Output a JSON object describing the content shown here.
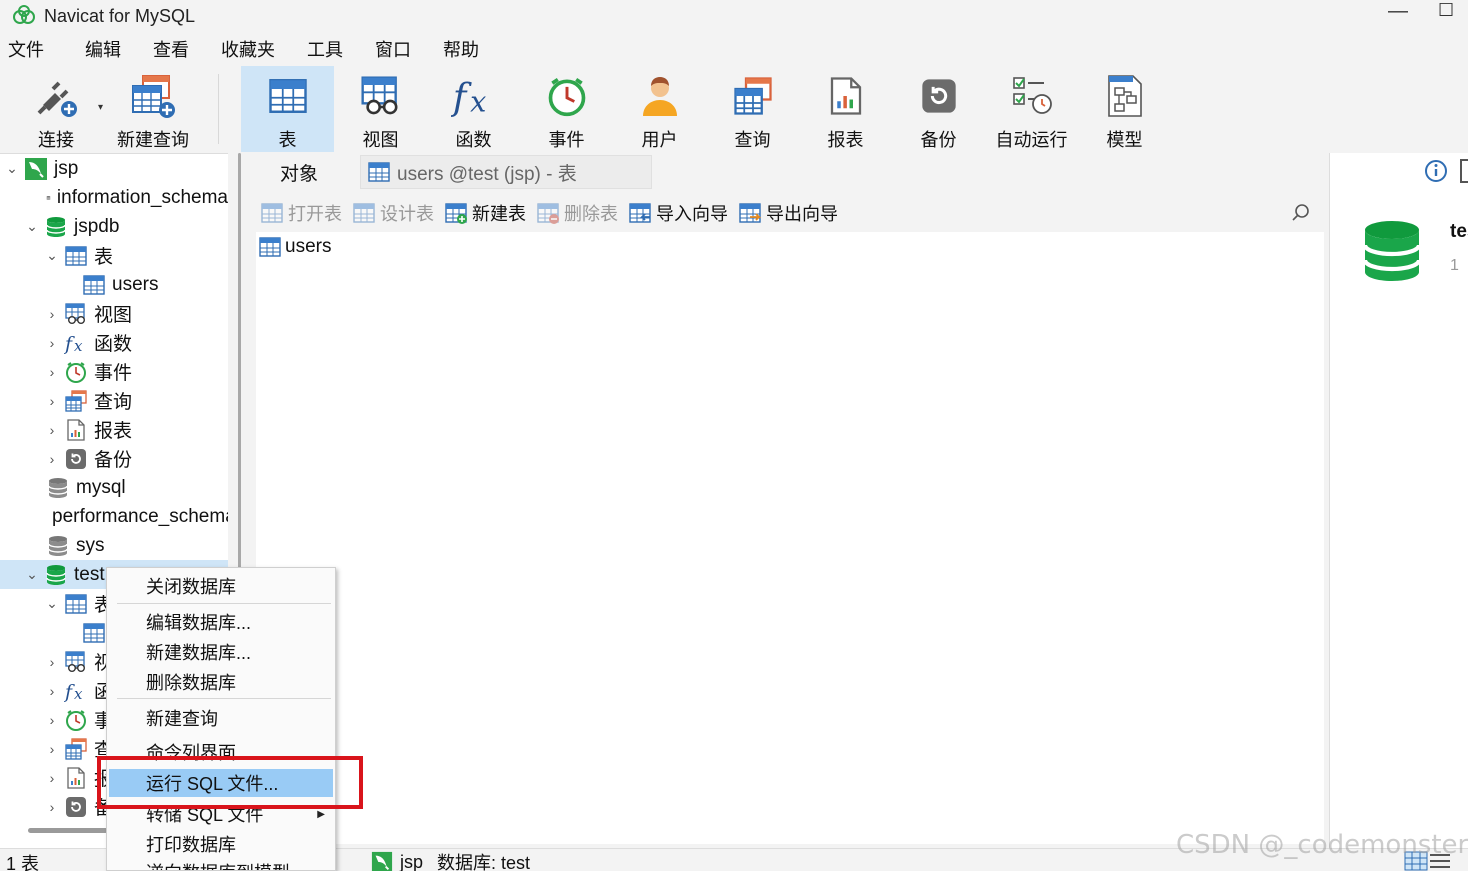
{
  "window": {
    "title": "Navicat for MySQL",
    "minimize": "—",
    "maximize": "☐"
  },
  "menu": [
    "文件",
    "编辑",
    "查看",
    "收藏夹",
    "工具",
    "窗口",
    "帮助"
  ],
  "toolbar": {
    "connect": "连接",
    "new_query": "新建查询",
    "table": "表",
    "view": "视图",
    "function": "函数",
    "event": "事件",
    "user": "用户",
    "query": "查询",
    "report": "报表",
    "backup": "备份",
    "autorun": "自动运行",
    "model": "模型"
  },
  "tree": {
    "conn": "jsp",
    "db1": "information_schema",
    "db2": "jspdb",
    "tables": "表",
    "users": "users",
    "views": "视图",
    "funcs": "函数",
    "events": "事件",
    "queries": "查询",
    "reports": "报表",
    "backups": "备份",
    "db3": "mysql",
    "db4": "performance_schema",
    "db5": "sys",
    "db6": "test",
    "t_tables": "表",
    "t_views": "视",
    "t_funcs": "函",
    "t_events": "事",
    "t_queries": "查",
    "t_reports": "报",
    "t_backups": "备"
  },
  "tabs": {
    "objects": "对象",
    "users_tab": "users @test (jsp) - 表"
  },
  "objbar": {
    "open": "打开表",
    "design": "设计表",
    "new": "新建表",
    "delete": "删除表",
    "import": "导入向导",
    "export": "导出向导"
  },
  "objlist": {
    "item": "users"
  },
  "info": {
    "name": "test",
    "count": "1"
  },
  "status": {
    "count": "1 表",
    "conn": "jsp",
    "db": "数据库: test"
  },
  "watermark": "CSDN @_codemonster",
  "context_menu": {
    "close_db": "关闭数据库",
    "edit_db": "编辑数据库...",
    "new_db": "新建数据库...",
    "delete_db": "删除数据库",
    "new_query": "新建查询",
    "console": "命令列界面",
    "run_sql": "运行 SQL 文件...",
    "dump_sql": "转储 SQL 文件",
    "print_db": "打印数据库",
    "reverse": "逆向数据库到模型..."
  },
  "colors": {
    "accent": "#cfe5f7",
    "highlight": "#99cbf5",
    "annotation": "#d9141b",
    "db_green": "#1aa64a"
  }
}
